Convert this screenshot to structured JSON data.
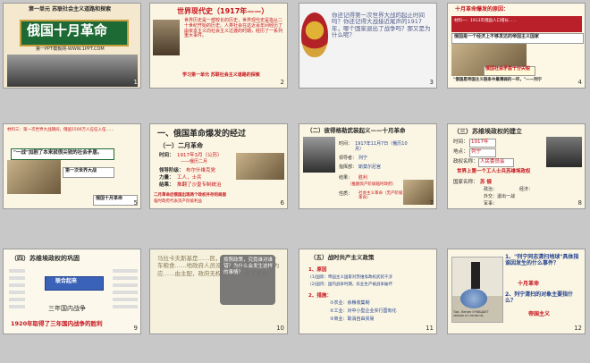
{
  "slides": [
    {
      "num": "1",
      "header": "第一单元 苏联社会主义道路和探索",
      "title": "俄国十月革命",
      "footer": "第一PPT模板网-WWW.1PPT.COM"
    },
    {
      "num": "2",
      "heading": "世界现代史（1917年——）",
      "body": "世界历史是一部较长的历史，世界现代史是指从二十世纪开始的历史。人类社会在这近百年间经历了由资本主义向社会主义过渡的时期，经历了一系列重大事件。",
      "tail": "学习第一单元 苏联社会主义道路的探索"
    },
    {
      "num": "3",
      "q1": "你还记得第一次世界大战的起止时间吗？你还记得大战接近尾声的1917年，哪个国家退出了战争吗？那又是为什么呢？"
    },
    {
      "num": "4",
      "head": "十月革命爆发的原因：",
      "mat": "材料一：1913年俄国人口增长……",
      "note": "俄国是一个经济上不够发达的帝国主义国家",
      "b1": "俄国社会矛盾十分尖锐",
      "b2": "\"俄国是帝国主义链条中最薄弱的一环。\"——列宁"
    },
    {
      "num": "5",
      "mat": "材料三：第一次世界大战期间，俄国1500万人应征入伍……",
      "q": "\"一战\"加剧了本来就很尖锐的社会矛盾。",
      "b1": "第一次世界大战",
      "b2": "俄国十月革命"
    },
    {
      "num": "6",
      "sec": "一、俄国革命爆发的经过",
      "sub": "（一）二月革命",
      "time_label": "时间：",
      "time_val": "1917年3月（公历）",
      "old": "——俄历二月",
      "lead_label": "领导阶级：",
      "lead_val": "布尔什维克党",
      "force_label": "力量：",
      "force_val": "工人，士兵",
      "result_label": "结果：",
      "result_val": "推翻了沙皇专制统治",
      "bottom1": "二月革命后俄国出现两个政权并存的局面",
      "bottom2": "临时政府代表资产阶级利益"
    },
    {
      "num": "7",
      "head": "（二）彼得格勒武装起义——十月革命",
      "time_label": "时间：",
      "time_val": "1917年11月7日（俄历10月）",
      "lead_label": "领导者：",
      "lead_val": "列宁",
      "cmd_label": "指挥部：",
      "cmd_val": "斯莫尔尼宫",
      "res_label": "结果：",
      "res_val": "胜利",
      "res_note": "（推翻资产阶级临时政府）",
      "sig_label": "性质：",
      "sig_val": "社会主义革命（无产阶级革命）"
    },
    {
      "num": "8",
      "head": "（三）苏维埃政权的建立",
      "time_label": "时间：",
      "time_val": "1917年",
      "place_label": "地点：",
      "place_val": "列宁",
      "gov_label": "政权名称：",
      "gov_val": "人民委员会",
      "note": "世界上第一个工人士兵苏维埃政权",
      "nation_label": "国家名称：",
      "nation_val": "苏 俄",
      "m1": "政治：",
      "m2": "经济：",
      "m3": "外交：退出一战",
      "m4": "军事："
    },
    {
      "num": "9",
      "head": "（四）苏维埃政权的巩固",
      "left": "三年国内战争",
      "bottom": "1920年取得了三年国内战争的胜利",
      "center": "联合起来"
    },
    {
      "num": "10",
      "text": "马拉卡夫斯基是……民，1919年一……拉着一车粮食……地政府人员没收……国家不能，认为应……由主配，政府无权过问……生了争执。",
      "bubble": "按照政策，究竟谁对谁错？为什么会发生这样的事情？"
    },
    {
      "num": "11",
      "sec": "（五）战时共产主义政策",
      "r_head": "1、原因",
      "r1": "(1)国际：帝国主义国家对苏维埃政权武装干涉",
      "r2": "(2)国内：国内战争时期，农业生产被战争破坏",
      "c_head": "2、措施：",
      "c1": "①农业：余粮收集制",
      "c2": "②工业：对中小型企业实行国有化",
      "c3": "③商业：取消自由贸易"
    },
    {
      "num": "12",
      "q1": "1、\"列宁同志清扫地球\"具体指谁因发生的什么事件？",
      "a1": "十月革命",
      "q2": "2、列宁清扫的对象主要指什么？",
      "a2": "帝国主义",
      "cap": "Тов. Ленин ОЧИЩАЕТ землю от нечисти."
    }
  ]
}
